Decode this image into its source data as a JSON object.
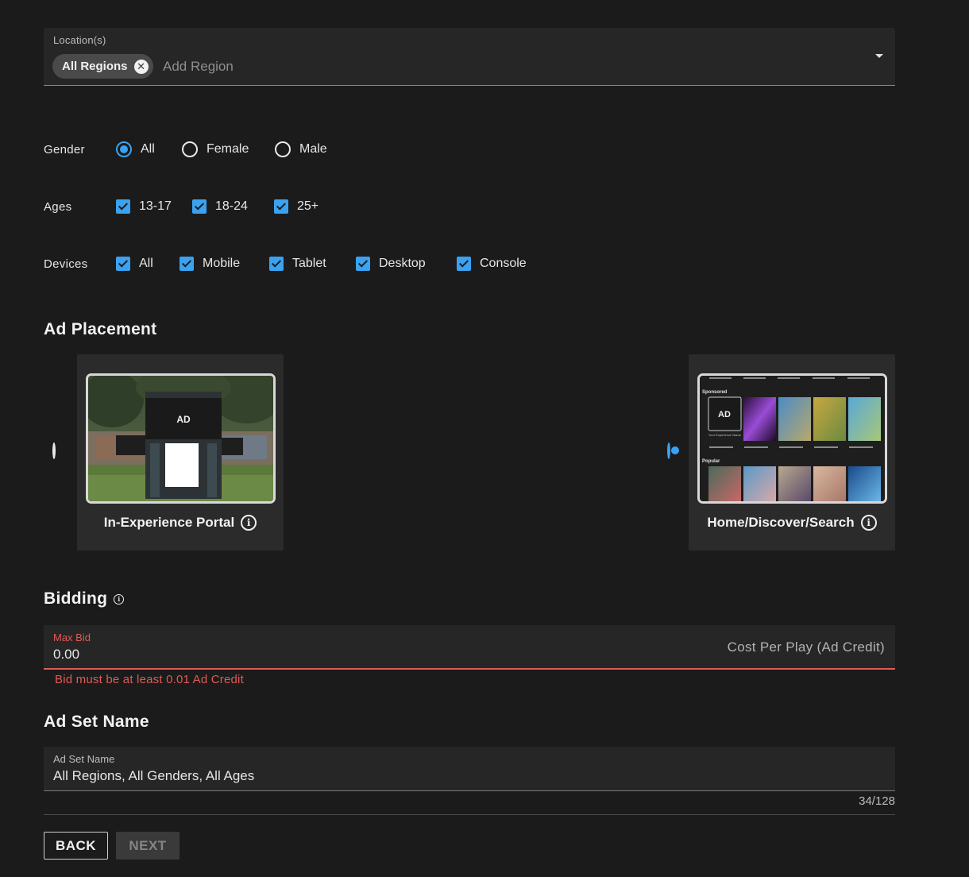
{
  "location": {
    "label": "Location(s)",
    "chip": "All Regions",
    "placeholder": "Add Region"
  },
  "gender": {
    "label": "Gender",
    "options": [
      {
        "label": "All",
        "selected": true
      },
      {
        "label": "Female",
        "selected": false
      },
      {
        "label": "Male",
        "selected": false
      }
    ]
  },
  "ages": {
    "label": "Ages",
    "options": [
      {
        "label": "13-17",
        "checked": true
      },
      {
        "label": "18-24",
        "checked": true
      },
      {
        "label": "25+",
        "checked": true
      }
    ]
  },
  "devices": {
    "label": "Devices",
    "options": [
      {
        "label": "All",
        "checked": true
      },
      {
        "label": "Mobile",
        "checked": true
      },
      {
        "label": "Tablet",
        "checked": true
      },
      {
        "label": "Desktop",
        "checked": true
      },
      {
        "label": "Console",
        "checked": true
      }
    ]
  },
  "placement": {
    "title": "Ad Placement",
    "cards": [
      {
        "label": "In-Experience Portal",
        "selected": false,
        "ad_text": "AD"
      },
      {
        "label": "Home/Discover/Search",
        "selected": true,
        "ad_text": "AD",
        "sponsored": "Sponsored",
        "popular": "Popular",
        "experience_name": "Your Experience Name"
      }
    ]
  },
  "bidding": {
    "title": "Bidding",
    "field_label": "Max Bid",
    "value": "0.00",
    "adornment": "Cost Per Play (Ad Credit)",
    "error": "Bid must be at least 0.01 Ad Credit"
  },
  "ad_set": {
    "title": "Ad Set Name",
    "field_label": "Ad Set Name",
    "value": "All Regions, All Genders, All Ages",
    "counter": "34/128"
  },
  "buttons": {
    "back": "BACK",
    "next": "NEXT"
  },
  "colors": {
    "background": "#1b1b1b",
    "accent": "#3aa2f0",
    "error": "#e05a55"
  }
}
